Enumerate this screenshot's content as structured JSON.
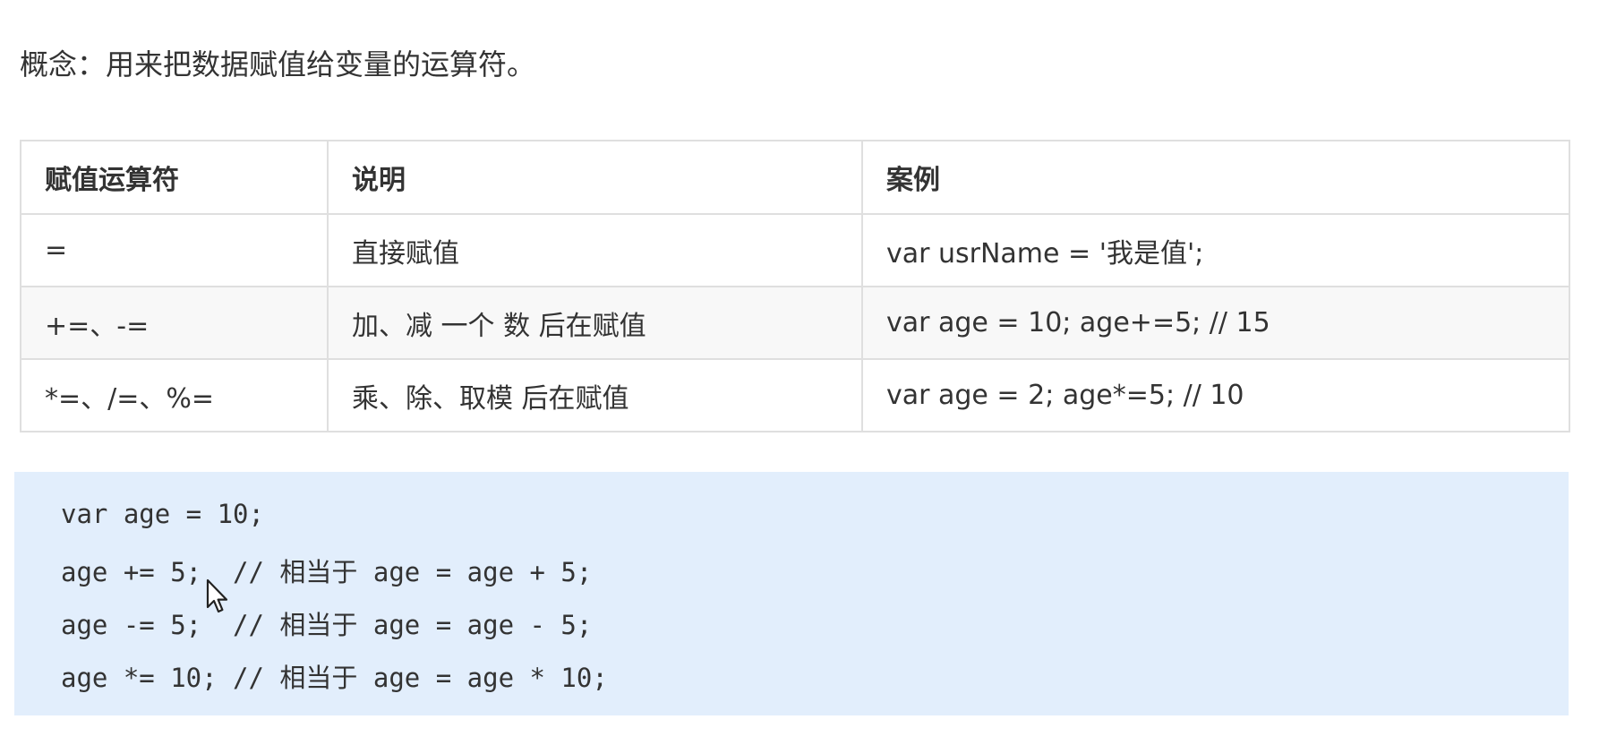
{
  "intro": "概念：用来把数据赋值给变量的运算符。",
  "table": {
    "headers": [
      "赋值运算符",
      "说明",
      "案例"
    ],
    "rows": [
      [
        "=",
        "直接赋值",
        "var usrName = '我是值';"
      ],
      [
        "+=、-=",
        "加、减 一个 数 后在赋值",
        "var age = 10;   age+=5;  // 15"
      ],
      [
        "*=、/=、%=",
        "乘、除、取模 后在赋值",
        "var age = 2;   age*=5; // 10"
      ]
    ]
  },
  "code": {
    "lines": [
      "var age = 10;",
      "age += 5;  // 相当于 age = age + 5;",
      "age -= 5;  // 相当于 age = age - 5;",
      "age *= 10; // 相当于 age = age * 10;"
    ]
  }
}
